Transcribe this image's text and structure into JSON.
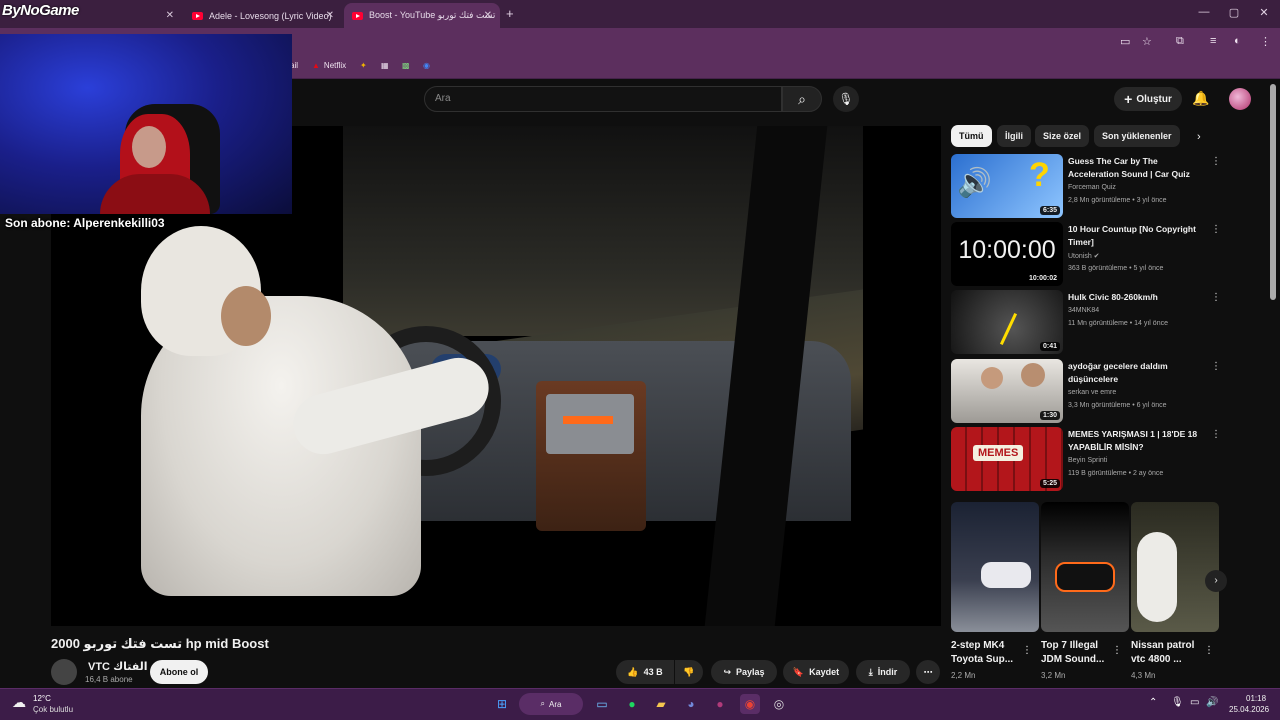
{
  "browser": {
    "tabs": [
      {
        "label": ""
      },
      {
        "label": "Adele - Lovesong (Lyric Video)"
      },
      {
        "label": "Boost - YouTube تست فتك توربو"
      }
    ],
    "new_tab": "+",
    "window_controls": {
      "minimize": "—",
      "maximize": "▢",
      "close": "✕"
    },
    "bookmarks": [
      {
        "label": "ail"
      },
      {
        "label": "Netflix"
      }
    ]
  },
  "stream_overlay": {
    "logo": "ByNoGame",
    "last_subscriber": "Son abone: Alperenkekilli03"
  },
  "youtube": {
    "search_placeholder": "Ara",
    "create_label": "Oluştur",
    "video": {
      "title": "2000 تست فتك توربو hp mid Boost",
      "channel": "VTC الفتاك",
      "subscribers": "16,4 B abone",
      "subscribe_label": "Abone ol",
      "likes": "43 B",
      "share_label": "Paylaş",
      "save_label": "Kaydet",
      "download_label": "İndir"
    },
    "chips": [
      "Tümü",
      "İlgili",
      "Size özel",
      "Son yüklenenler"
    ],
    "recommendations": [
      {
        "title": "Guess The Car by The Acceleration Sound | Car Quiz",
        "channel": "Forceman Quiz",
        "meta": "2,8 Mn görüntüleme • 3 yıl önce",
        "duration": "6:35",
        "thumb_color": "#2b6fd0"
      },
      {
        "title": "10 Hour Countup [No Copyright Timer]",
        "channel": "Utonish ✔",
        "meta": "363 B görüntüleme • 5 yıl önce",
        "duration": "10:00:02",
        "thumb_text": "10:00:00",
        "thumb_color": "#000000"
      },
      {
        "title": "Hulk Civic 80-260km/h",
        "channel": "34MNK84",
        "meta": "11 Mn görüntüleme • 14 yıl önce",
        "duration": "0:41",
        "thumb_color": "#2a2a2a"
      },
      {
        "title": "aydoğar gecelere daldım düşüncelere",
        "channel": "serkan ve emre",
        "meta": "3,3 Mn görüntüleme • 6 yıl önce",
        "duration": "1:30",
        "thumb_color": "#d8d4cf"
      },
      {
        "title": "MEMES YARIŞMASI 1 | 18'DE 18 YAPABİLİR MİSİN?",
        "channel": "Beyin Sprinti",
        "meta": "119 B görüntüleme • 2 ay önce",
        "duration": "5:25",
        "thumb_color": "#b3161b"
      }
    ],
    "shorts": [
      {
        "title": "2-step MK4 Toyota Sup...",
        "views": "2,2 Mn"
      },
      {
        "title": "Top 7 Illegal JDM Sound...",
        "views": "3,2 Mn"
      },
      {
        "title": "Nissan patrol vtc 4800 ...",
        "views": "4,3 Mn"
      }
    ]
  },
  "taskbar": {
    "weather_temp": "12°C",
    "weather_desc": "Çok bulutlu",
    "search_label": "Ara",
    "time": "01:18",
    "date": "25.04.2026"
  }
}
